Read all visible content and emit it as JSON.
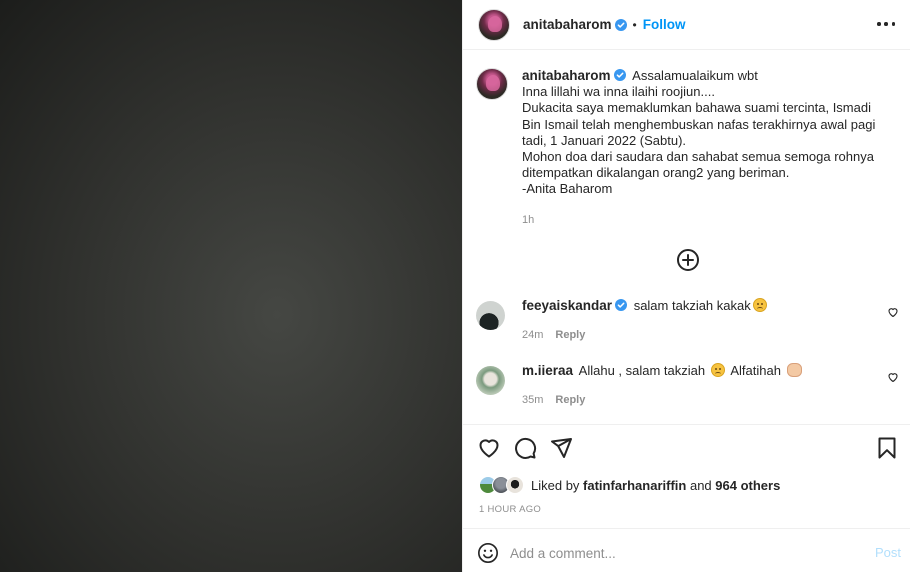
{
  "post": {
    "owner": "anitabaharom",
    "follow_label": "Follow",
    "separator": "•"
  },
  "caption": {
    "username": "anitabaharom",
    "lines": [
      "Assalamualaikum wbt",
      "Inna lillahi wa inna ilaihi roojiun....",
      "Dukacita saya memaklumkan bahawa suami tercinta, Ismadi Bin Ismail telah menghembuskan nafas terakhirnya awal pagi tadi, 1 Januari 2022 (Sabtu).",
      "Mohon doa dari saudara dan sahabat semua semoga rohnya ditempatkan dikalangan orang2 yang beriman.",
      "-Anita Baharom"
    ],
    "time": "1h"
  },
  "comments": [
    {
      "username": "feeyaiskandar",
      "text": "salam takziah kakak",
      "time": "24m",
      "reply_label": "Reply"
    },
    {
      "username": "m.iieraa",
      "text_parts": [
        "Allahu , salam takziah",
        "Alfatihah"
      ],
      "time": "35m",
      "reply_label": "Reply"
    }
  ],
  "likes": {
    "prefix": "Liked by",
    "user": "fatinfarhanariffin",
    "conjunction": "and",
    "others": "964 others"
  },
  "timestamp": "1 HOUR AGO",
  "add_comment": {
    "placeholder": "Add a comment...",
    "post_label": "Post"
  },
  "icons": {
    "more": "more-horizontal-icon",
    "load_more": "plus-circle-icon",
    "like": "heart-icon",
    "comment": "comment-icon",
    "share": "paper-plane-icon",
    "save": "bookmark-icon",
    "emoji": "smiley-icon",
    "verified": "verified-badge-icon"
  },
  "colors": {
    "accent": "#0095f6",
    "verified": "#3897f0",
    "muted": "#8e8e8e",
    "post_disabled": "#b2dffc"
  }
}
